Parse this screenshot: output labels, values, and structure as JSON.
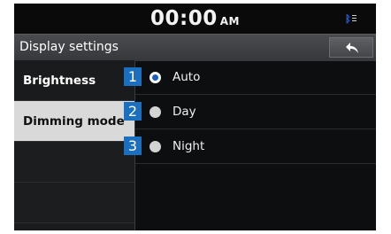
{
  "status": {
    "time": "00:00",
    "ampm": "AM"
  },
  "header": {
    "title": "Display settings",
    "back_icon": "back-arrow-icon"
  },
  "sidebar": {
    "items": [
      {
        "label": "Brightness",
        "selected": false
      },
      {
        "label": "Dimming mode",
        "selected": true
      }
    ]
  },
  "options": [
    {
      "number": "1",
      "label": "Auto",
      "selected": true
    },
    {
      "number": "2",
      "label": "Day",
      "selected": false
    },
    {
      "number": "3",
      "label": "Night",
      "selected": false
    }
  ],
  "colors": {
    "accent": "#1b6fbf",
    "selected_bg": "#d9d9d9",
    "bluetooth": "#2a6ce8"
  }
}
